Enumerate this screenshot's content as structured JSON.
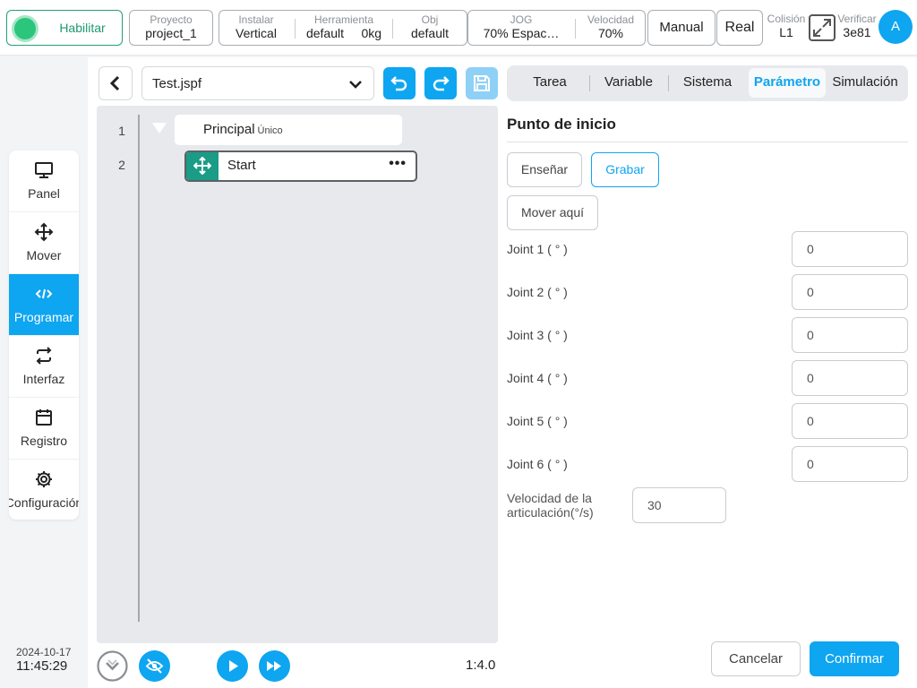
{
  "header": {
    "enable_label": "Habilitar",
    "project": {
      "label": "Proyecto",
      "value": "project_1"
    },
    "install": {
      "label": "Instalar",
      "value": "Vertical"
    },
    "tool": {
      "label": "Herramienta",
      "value": "default",
      "value2": "0kg"
    },
    "obj": {
      "label": "Obj",
      "value": "default"
    },
    "jog": {
      "label": "JOG",
      "value": "70%   Espac…"
    },
    "speed": {
      "label": "Velocidad",
      "value": "70%"
    },
    "mode_button": "Manual",
    "real_button": "Real",
    "collision": {
      "label": "Colisión",
      "value": "L1"
    },
    "verify": {
      "label": "Verificar",
      "value": "3e81"
    },
    "avatar_letter": "A"
  },
  "nav": {
    "items": [
      {
        "label": "Panel",
        "icon": "monitor-icon"
      },
      {
        "label": "Mover",
        "icon": "move-icon"
      },
      {
        "label": "Programar",
        "icon": "code-icon"
      },
      {
        "label": "Interfaz",
        "icon": "swap-icon"
      },
      {
        "label": "Registro",
        "icon": "calendar-icon"
      },
      {
        "label": "Configuración",
        "icon": "gear-icon"
      }
    ],
    "active_index": 2
  },
  "clock": {
    "date": "2024-10-17",
    "time": "11:45:29"
  },
  "program": {
    "file_name": "Test.jspf",
    "tree": [
      {
        "line": "1",
        "title": "Principal",
        "subtitle": "Único"
      },
      {
        "line": "2",
        "title": "Start"
      }
    ],
    "ratio": "1:4.0"
  },
  "tabs": [
    "Tarea",
    "Variable",
    "Sistema",
    "Parámetro",
    "Simulación"
  ],
  "active_tab": "Parámetro",
  "params": {
    "section_title": "Punto de inicio",
    "teach_button": "Enseñar",
    "record_button": "Grabar",
    "move_here_button": "Mover aquí",
    "joints": [
      {
        "label": "Joint 1 ( ° )",
        "value": "0"
      },
      {
        "label": "Joint 2 ( ° )",
        "value": "0"
      },
      {
        "label": "Joint 3 ( ° )",
        "value": "0"
      },
      {
        "label": "Joint 4 ( ° )",
        "value": "0"
      },
      {
        "label": "Joint 5 ( ° )",
        "value": "0"
      },
      {
        "label": "Joint 6 ( ° )",
        "value": "0"
      }
    ],
    "joint_speed_label": "Velocidad de la articulación(°/s)",
    "joint_speed_value": "30",
    "cancel_button": "Cancelar",
    "confirm_button": "Confirmar"
  },
  "colors": {
    "accent": "#0ea5f1",
    "enabled": "#2bc57c",
    "handle": "#1a9c86"
  }
}
